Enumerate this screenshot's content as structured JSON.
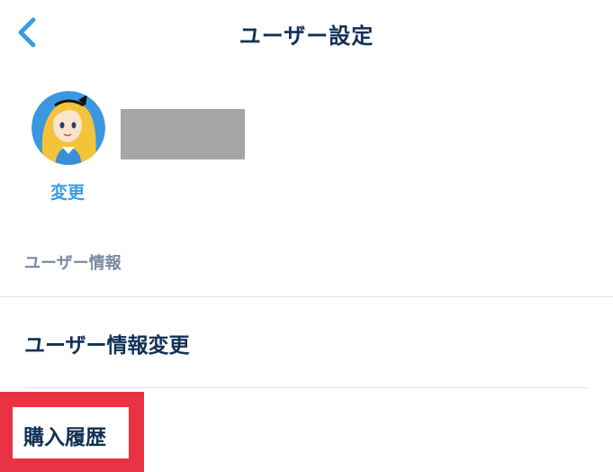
{
  "header": {
    "title": "ユーザー設定"
  },
  "profile": {
    "change_label": "変更"
  },
  "section": {
    "label": "ユーザー情報"
  },
  "menu": {
    "items": [
      {
        "label": "ユーザー情報変更"
      },
      {
        "label": "購入履歴"
      }
    ]
  },
  "colors": {
    "primary_text": "#123057",
    "link": "#3a9de2",
    "section_label": "#7b8ba3",
    "highlight": "#e93244",
    "divider": "#dfe4e9"
  }
}
